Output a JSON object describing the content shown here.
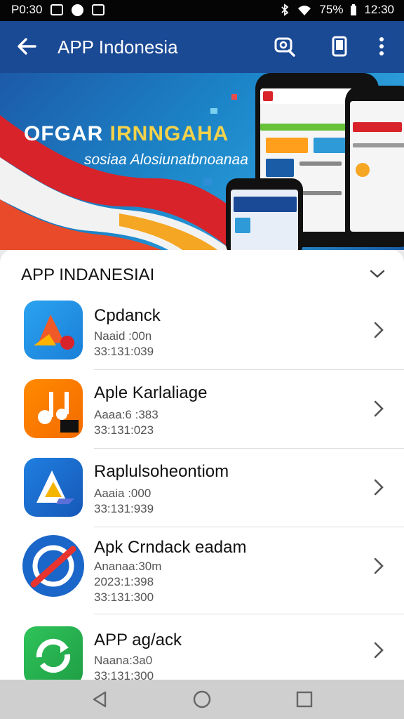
{
  "status": {
    "time": "P0:30",
    "battery": "75%",
    "clock": "12:30"
  },
  "appbar": {
    "title": "APP Indonesia"
  },
  "banner": {
    "headline_a": "OFGAR",
    "headline_b": "IRNNGAHA",
    "subline": "sosiaa Alosiunatbnoanaa"
  },
  "sheet": {
    "title": "APP INDANESIAI"
  },
  "apps": [
    {
      "name": "Cpdanck",
      "meta": [
        "Naaid :00n",
        "33:131:039"
      ]
    },
    {
      "name": "Aple Karlaliage",
      "meta": [
        "Aaaa:6 :383",
        "33:131:023"
      ]
    },
    {
      "name": "Raplulsoheontiom",
      "meta": [
        "Aaaia :000",
        "33:131:939"
      ]
    },
    {
      "name": "Apk Crndack eadam",
      "meta": [
        "Ananaa:30m",
        "2023:1:398",
        "33:131:300"
      ]
    },
    {
      "name": "APP ag/ack",
      "meta": [
        "Naana:3a0",
        "33:131:300"
      ]
    }
  ]
}
